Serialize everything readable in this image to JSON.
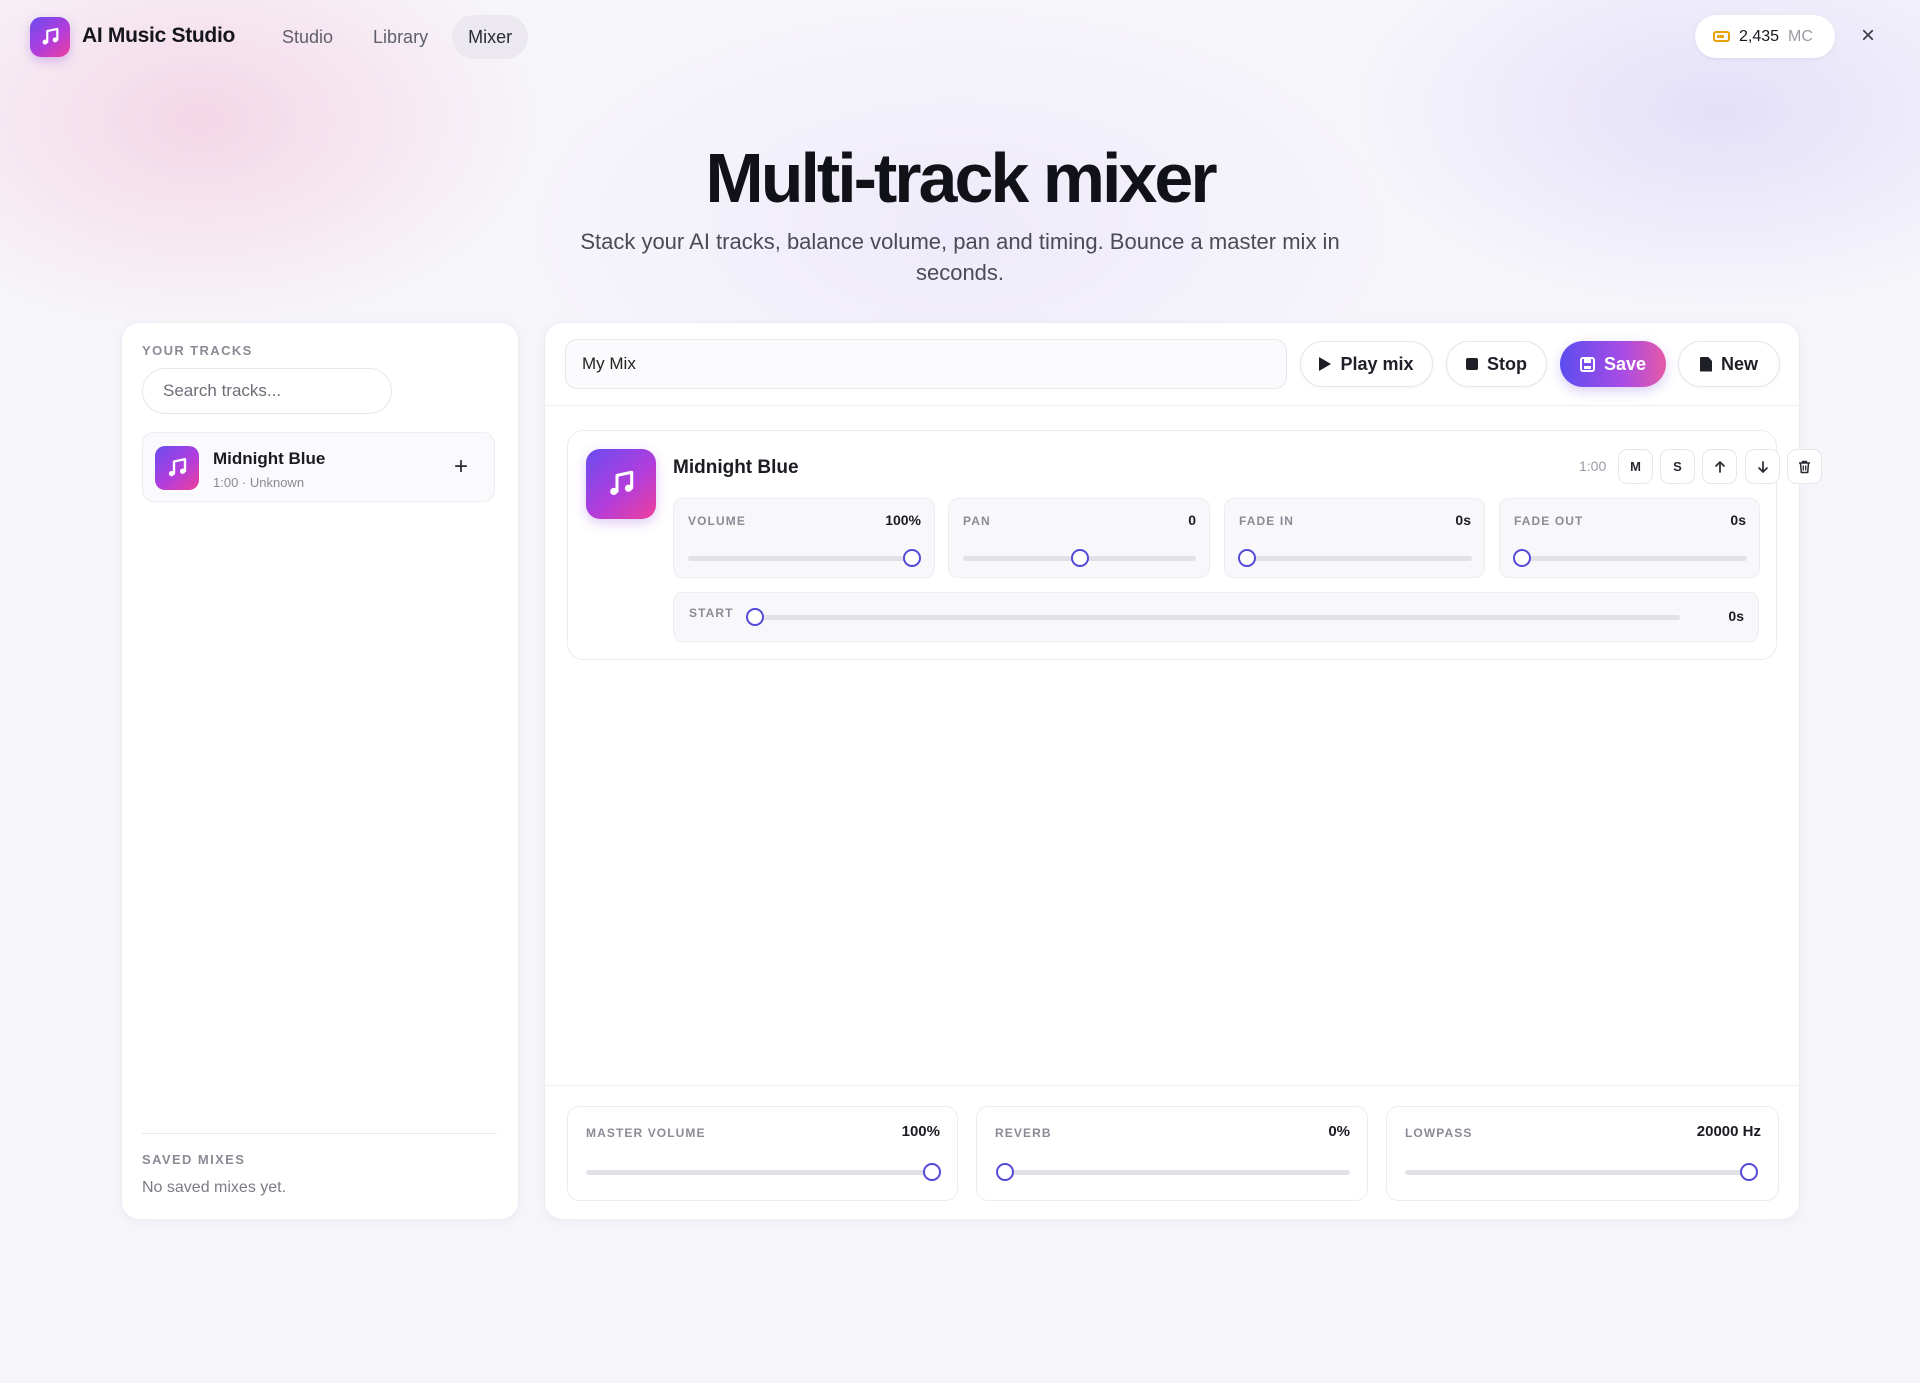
{
  "app": {
    "name": "AI Music Studio"
  },
  "nav": {
    "tabs": [
      "Studio",
      "Library",
      "Mixer"
    ],
    "active": "Mixer"
  },
  "credits": {
    "amount": "2,435",
    "unit": "MC"
  },
  "close_label": "×",
  "hero": {
    "title": "Multi-track mixer",
    "subtitle": "Stack your AI tracks, balance volume, pan and timing. Bounce a master mix in seconds."
  },
  "sidebar": {
    "tracks_label": "YOUR TRACKS",
    "search_placeholder": "Search tracks...",
    "tracks": [
      {
        "title": "Midnight Blue",
        "meta": "1:00 · Unknown",
        "add_label": "+"
      }
    ],
    "saved_label": "SAVED MIXES",
    "saved_empty": "No saved mixes yet."
  },
  "toolbar": {
    "mix_name": "My Mix",
    "play_label": "Play mix",
    "stop_label": "Stop",
    "save_label": "Save",
    "new_label": "New"
  },
  "track": {
    "title": "Midnight Blue",
    "duration": "1:00",
    "mute_label": "M",
    "solo_label": "S",
    "params": {
      "volume": {
        "label": "VOLUME",
        "value": "100%",
        "fraction": 1.0
      },
      "pan": {
        "label": "PAN",
        "value": "0",
        "fraction": 0.5
      },
      "fade_in": {
        "label": "FADE IN",
        "value": "0s",
        "fraction": 0.0
      },
      "fade_out": {
        "label": "FADE OUT",
        "value": "0s",
        "fraction": 0.0
      },
      "start": {
        "label": "START",
        "value": "0s",
        "fraction": 0.0
      }
    }
  },
  "master": {
    "volume": {
      "label": "MASTER VOLUME",
      "value": "100%",
      "fraction": 1.0
    },
    "reverb": {
      "label": "REVERB",
      "value": "0%",
      "fraction": 0.0
    },
    "lowpass": {
      "label": "LOWPASS",
      "value": "20000 Hz",
      "fraction": 1.0
    }
  },
  "colors": {
    "accent": "#5549d8",
    "gradient_start": "#6a4cf0",
    "gradient_end": "#ee3f9a",
    "coin": "#e8a30b"
  },
  "icons": {
    "logo": "music-note-icon",
    "play": "play-icon",
    "stop": "stop-icon",
    "save": "floppy-disk-icon",
    "new": "document-icon",
    "up": "arrow-up-icon",
    "down": "arrow-down-icon",
    "delete": "trash-icon"
  }
}
